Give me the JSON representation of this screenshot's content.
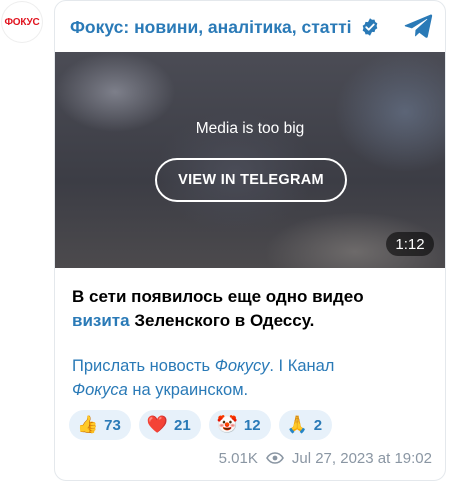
{
  "avatar": {
    "logo_text": "ФОКУС"
  },
  "header": {
    "channel_title": "Фокус: новини, аналітика, статті"
  },
  "media": {
    "message": "Media is too big",
    "view_button_label": "VIEW IN TELEGRAM",
    "duration": "1:12"
  },
  "post": {
    "line1": "В сети появилось еще одно видео",
    "link_word": "визита",
    "line2_rest": " Зеленского в Одессу."
  },
  "links": {
    "send_news_prefix": "Прислать новость ",
    "send_news_italic": "Фокусу",
    "period": ".",
    "separator": " I ",
    "channel_label": "Канал",
    "channel_italic": "Фокуса",
    "channel_rest": " на украинском."
  },
  "reactions": [
    {
      "emoji": "👍",
      "count": "73"
    },
    {
      "emoji": "❤️",
      "count": "21"
    },
    {
      "emoji": "🤡",
      "count": "12"
    },
    {
      "emoji": "🙏",
      "count": "2"
    }
  ],
  "meta": {
    "views": "5.01K",
    "datetime": "Jul 27, 2023 at 19:02"
  },
  "colors": {
    "accent": "#2a7ab7",
    "brand_red": "#e1141f",
    "reaction_bg": "#e7f1fa",
    "meta_gray": "#8a96a3"
  },
  "icons": {
    "verified": "verified-badge-icon",
    "telegram": "telegram-icon",
    "views": "eye-icon"
  }
}
